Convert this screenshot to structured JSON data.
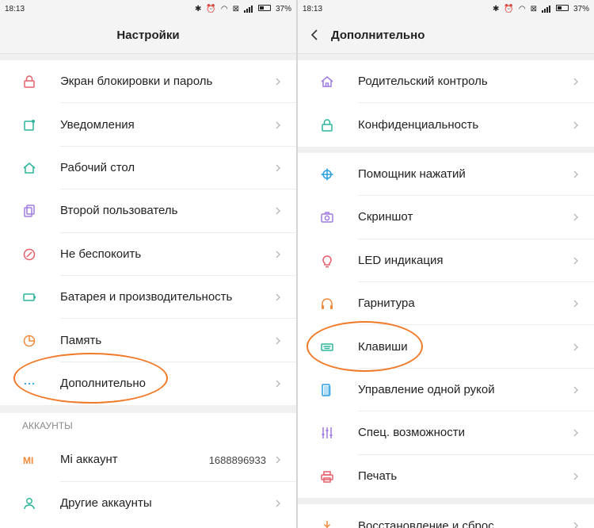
{
  "left": {
    "status": {
      "time": "18:13",
      "battery": "37%"
    },
    "title": "Настройки",
    "items": [
      {
        "label": "Экран блокировки и пароль",
        "icon": "lock-icon",
        "color": "#e5606b"
      },
      {
        "label": "Уведомления",
        "icon": "notification-icon",
        "color": "#2bb59b"
      },
      {
        "label": "Рабочий стол",
        "icon": "home-icon",
        "color": "#2bb59b"
      },
      {
        "label": "Второй пользователь",
        "icon": "second-user-icon",
        "color": "#a07be0"
      },
      {
        "label": "Не беспокоить",
        "icon": "do-not-disturb-icon",
        "color": "#e5606b"
      },
      {
        "label": "Батарея и производительность",
        "icon": "battery-icon",
        "color": "#2bb59b"
      },
      {
        "label": "Память",
        "icon": "storage-icon",
        "color": "#f08a3a"
      },
      {
        "label": "Дополнительно",
        "icon": "more-icon",
        "color": "#2a9fe0"
      }
    ],
    "accounts_header": "АККАУНТЫ",
    "accounts": [
      {
        "label": "Mi аккаунт",
        "value": "1688896933",
        "icon": "mi-icon",
        "color": "#f08a3a"
      },
      {
        "label": "Другие аккаунты",
        "icon": "person-icon",
        "color": "#2bb59b"
      }
    ]
  },
  "right": {
    "status": {
      "time": "18:13",
      "battery": "37%"
    },
    "title": "Дополнительно",
    "group1": [
      {
        "label": "Родительский контроль",
        "icon": "home-outline-icon",
        "color": "#a07be0"
      },
      {
        "label": "Конфиденциальность",
        "icon": "lock-icon",
        "color": "#2bb59b"
      }
    ],
    "group2": [
      {
        "label": "Помощник нажатий",
        "icon": "crosshair-icon",
        "color": "#2a9fe0"
      },
      {
        "label": "Скриншот",
        "icon": "camera-icon",
        "color": "#a07be0"
      },
      {
        "label": "LED индикация",
        "icon": "bulb-icon",
        "color": "#e5606b"
      },
      {
        "label": "Гарнитура",
        "icon": "headphones-icon",
        "color": "#f08a3a"
      },
      {
        "label": "Клавиши",
        "icon": "keyboard-icon",
        "color": "#2bb59b"
      },
      {
        "label": "Управление одной рукой",
        "icon": "one-hand-icon",
        "color": "#2a9fe0"
      },
      {
        "label": "Спец. возможности",
        "icon": "sliders-icon",
        "color": "#a07be0"
      },
      {
        "label": "Печать",
        "icon": "printer-icon",
        "color": "#e5606b"
      }
    ],
    "group3": [
      {
        "label": "Восстановление и сброс",
        "icon": "reset-icon",
        "color": "#f08a3a"
      }
    ]
  },
  "highlight_color": "#f07a28"
}
